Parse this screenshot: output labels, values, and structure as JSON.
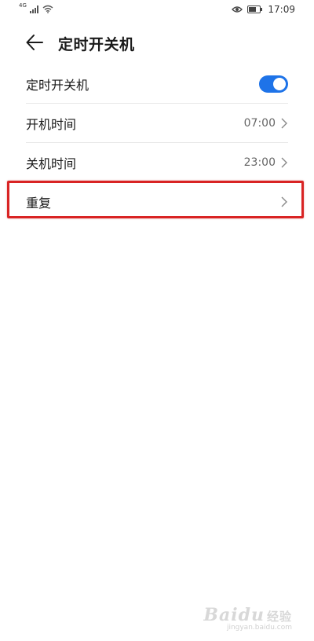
{
  "status_bar": {
    "network_label": "4G",
    "time": "17:09",
    "icons": [
      "signal-icon",
      "wifi-icon",
      "eye-icon",
      "battery-icon"
    ]
  },
  "header": {
    "title": "定时开关机",
    "back_icon": "arrow-left-icon"
  },
  "settings": {
    "items": [
      {
        "label": "定时开关机",
        "type": "toggle",
        "enabled": true
      },
      {
        "label": "开机时间",
        "value": "07:00",
        "type": "link"
      },
      {
        "label": "关机时间",
        "value": "23:00",
        "type": "link"
      },
      {
        "label": "重复",
        "value": "",
        "type": "link",
        "highlighted": true
      }
    ]
  },
  "watermark": {
    "logo": "Baidu",
    "suffix": "经验",
    "url": "jingyan.baidu.com"
  },
  "colors": {
    "accent": "#1e73e8",
    "highlight": "#d92424",
    "divider": "#e8e8e8"
  }
}
